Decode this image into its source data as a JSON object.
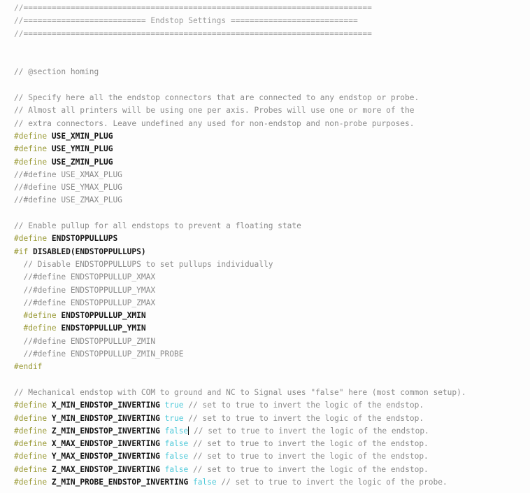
{
  "editor": {
    "filename": "Configuration.h",
    "background_color": "#fdfdfd",
    "colors": {
      "comment": "#8b8b8b",
      "separator": "#9b9b9b",
      "preprocessor_keyword": "#9a9a36",
      "identifier": "#161616",
      "boolean_literal": "#4ec9d9",
      "plain_text": "#1f1f1f",
      "caret": "#101010"
    },
    "caret": {
      "visible": true,
      "after_token": "false",
      "on_line_text": "#define Z_MIN_ENDSTOP_INVERTING false"
    },
    "separator_run": "================================================================",
    "lines": [
      {
        "id": "sep-top",
        "kind": "separator",
        "text": "//=========================================================================="
      },
      {
        "id": "sep-title",
        "kind": "separator-title",
        "prefix": "//========================== ",
        "title": "Endstop Settings",
        "suffix": " ==========================="
      },
      {
        "id": "sep-bottom",
        "kind": "separator",
        "text": "//=========================================================================="
      },
      {
        "id": "blank-1",
        "kind": "blank",
        "text": ""
      },
      {
        "id": "blank-2",
        "kind": "blank",
        "text": ""
      },
      {
        "id": "section-homing",
        "kind": "comment",
        "text": "// @section homing"
      },
      {
        "id": "blank-3",
        "kind": "blank",
        "text": ""
      },
      {
        "id": "cmt-specify",
        "kind": "comment",
        "text": "// Specify here all the endstop connectors that are connected to any endstop or probe."
      },
      {
        "id": "cmt-almost",
        "kind": "comment",
        "text": "// Almost all printers will be using one per axis. Probes will use one or more of the"
      },
      {
        "id": "cmt-extra",
        "kind": "comment",
        "text": "// extra connectors. Leave undefined any used for non-endstop and non-probe purposes."
      },
      {
        "id": "def-use-xmin",
        "kind": "define",
        "indent": "",
        "keyword": "#define",
        "identifier": "USE_XMIN_PLUG",
        "value": "",
        "trailing_comment": ""
      },
      {
        "id": "def-use-ymin",
        "kind": "define",
        "indent": "",
        "keyword": "#define",
        "identifier": "USE_YMIN_PLUG",
        "value": "",
        "trailing_comment": ""
      },
      {
        "id": "def-use-zmin",
        "kind": "define",
        "indent": "",
        "keyword": "#define",
        "identifier": "USE_ZMIN_PLUG",
        "value": "",
        "trailing_comment": ""
      },
      {
        "id": "def-use-xmax",
        "kind": "comment",
        "text": "//#define USE_XMAX_PLUG"
      },
      {
        "id": "def-use-ymax",
        "kind": "comment",
        "text": "//#define USE_YMAX_PLUG"
      },
      {
        "id": "def-use-zmax",
        "kind": "comment",
        "text": "//#define USE_ZMAX_PLUG"
      },
      {
        "id": "blank-4",
        "kind": "blank",
        "text": ""
      },
      {
        "id": "cmt-pullup",
        "kind": "comment",
        "text": "// Enable pullup for all endstops to prevent a floating state"
      },
      {
        "id": "def-endstoppullups",
        "kind": "define",
        "indent": "",
        "keyword": "#define",
        "identifier": "ENDSTOPPULLUPS",
        "value": "",
        "trailing_comment": ""
      },
      {
        "id": "if-disabled",
        "kind": "define",
        "indent": "",
        "keyword": "#if",
        "identifier": "DISABLED(ENDSTOPPULLUPS)",
        "value": "",
        "trailing_comment": ""
      },
      {
        "id": "cmt-disable-indiv",
        "kind": "comment",
        "text": "  // Disable ENDSTOPPULLUPS to set pullups individually"
      },
      {
        "id": "pullup-xmax",
        "kind": "comment",
        "text": "  //#define ENDSTOPPULLUP_XMAX"
      },
      {
        "id": "pullup-ymax",
        "kind": "comment",
        "text": "  //#define ENDSTOPPULLUP_YMAX"
      },
      {
        "id": "pullup-zmax",
        "kind": "comment",
        "text": "  //#define ENDSTOPPULLUP_ZMAX"
      },
      {
        "id": "pullup-xmin",
        "kind": "define",
        "indent": "  ",
        "keyword": "#define",
        "identifier": "ENDSTOPPULLUP_XMIN",
        "value": "",
        "trailing_comment": ""
      },
      {
        "id": "pullup-ymin",
        "kind": "define",
        "indent": "  ",
        "keyword": "#define",
        "identifier": "ENDSTOPPULLUP_YMIN",
        "value": "",
        "trailing_comment": ""
      },
      {
        "id": "pullup-zmin",
        "kind": "comment",
        "text": "  //#define ENDSTOPPULLUP_ZMIN"
      },
      {
        "id": "pullup-zmin-probe",
        "kind": "comment",
        "text": "  //#define ENDSTOPPULLUP_ZMIN_PROBE"
      },
      {
        "id": "endif-1",
        "kind": "define",
        "indent": "",
        "keyword": "#endif",
        "identifier": "",
        "value": "",
        "trailing_comment": ""
      },
      {
        "id": "blank-5",
        "kind": "blank",
        "text": ""
      },
      {
        "id": "cmt-mechanical",
        "kind": "comment",
        "text": "// Mechanical endstop with COM to ground and NC to Signal uses \"false\" here (most common setup)."
      },
      {
        "id": "inv-x-min",
        "kind": "define",
        "indent": "",
        "keyword": "#define",
        "identifier": "X_MIN_ENDSTOP_INVERTING",
        "value": "true",
        "trailing_comment": "// set to true to invert the logic of the endstop."
      },
      {
        "id": "inv-y-min",
        "kind": "define",
        "indent": "",
        "keyword": "#define",
        "identifier": "Y_MIN_ENDSTOP_INVERTING",
        "value": "true",
        "trailing_comment": "// set to true to invert the logic of the endstop."
      },
      {
        "id": "inv-z-min",
        "kind": "define",
        "indent": "",
        "keyword": "#define",
        "identifier": "Z_MIN_ENDSTOP_INVERTING",
        "value": "false",
        "caret_after_value": true,
        "trailing_comment": "// set to true to invert the logic of the endstop."
      },
      {
        "id": "inv-x-max",
        "kind": "define",
        "indent": "",
        "keyword": "#define",
        "identifier": "X_MAX_ENDSTOP_INVERTING",
        "value": "false",
        "trailing_comment": "// set to true to invert the logic of the endstop."
      },
      {
        "id": "inv-y-max",
        "kind": "define",
        "indent": "",
        "keyword": "#define",
        "identifier": "Y_MAX_ENDSTOP_INVERTING",
        "value": "false",
        "trailing_comment": "// set to true to invert the logic of the endstop."
      },
      {
        "id": "inv-z-max",
        "kind": "define",
        "indent": "",
        "keyword": "#define",
        "identifier": "Z_MAX_ENDSTOP_INVERTING",
        "value": "false",
        "trailing_comment": "// set to true to invert the logic of the endstop."
      },
      {
        "id": "inv-z-min-probe",
        "kind": "define",
        "indent": "",
        "keyword": "#define",
        "identifier": "Z_MIN_PROBE_ENDSTOP_INVERTING",
        "value": "false",
        "trailing_comment": "// set to true to invert the logic of the probe."
      }
    ]
  }
}
